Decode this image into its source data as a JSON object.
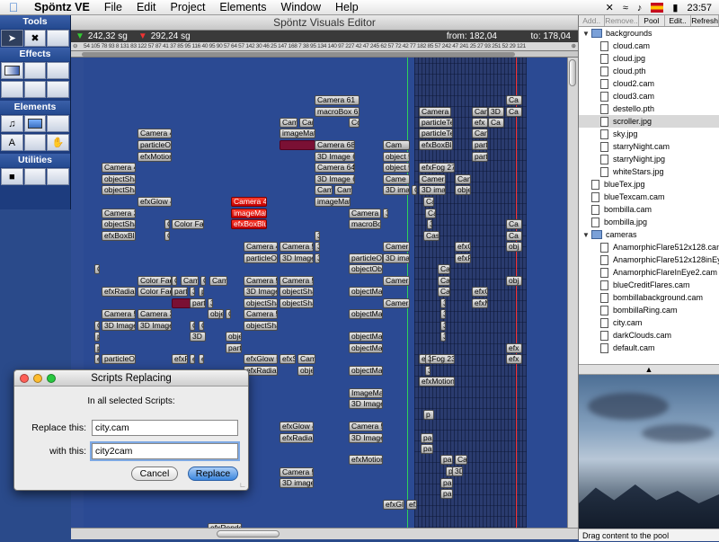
{
  "menubar": {
    "app": "Spöntz VE",
    "items": [
      "File",
      "Edit",
      "Project",
      "Elements",
      "Window",
      "Help"
    ],
    "time": "23:57"
  },
  "tools": {
    "sections": [
      "Tools",
      "Effects",
      "Elements",
      "Utilities"
    ]
  },
  "editor": {
    "title": "Spöntz Visuals Editor",
    "pos1": "242,32 sg",
    "pos2": "292,24 sg",
    "from_label": "from: 182,04",
    "to_label": "to: 178,04",
    "ruler": "54 105 78 93 8 131 83 122 57 87 41 37 85 95 116 40 95 90 57 64 57 142 30 46 25 147 168 7 38 95 134 140 97 227 42 47 245 62 57 72 42 77 182 85 57 242 47 241 25 27 93 251 52 29 121"
  },
  "clips": [
    [
      "Camera 61",
      257,
      42,
      50
    ],
    [
      "macroBox 62",
      257,
      55,
      50
    ],
    [
      "Cam",
      218,
      67,
      20
    ],
    [
      "Cam",
      240,
      67,
      16
    ],
    [
      "Co",
      295,
      67,
      12
    ],
    [
      "imageMatr",
      218,
      79,
      40
    ],
    [
      "",
      218,
      92,
      40,
      "mar"
    ],
    [
      "Camera 4",
      60,
      79,
      38
    ],
    [
      "particleOb",
      60,
      92,
      38
    ],
    [
      "efxMotion",
      60,
      105,
      38
    ],
    [
      "Camera 68",
      257,
      92,
      45
    ],
    [
      "3D Image 69",
      257,
      105,
      45
    ],
    [
      "Camera 64",
      257,
      117,
      45
    ],
    [
      "3D Image 65",
      257,
      130,
      45
    ],
    [
      "Cam",
      257,
      142,
      20
    ],
    [
      "Cam",
      279,
      142,
      20
    ],
    [
      "Camera 4",
      20,
      117,
      38
    ],
    [
      "objectSha",
      20,
      130,
      38
    ],
    [
      "objectSha",
      20,
      142,
      38
    ],
    [
      "efxGlow 4",
      60,
      155,
      38
    ],
    [
      "imageMatr",
      257,
      155,
      40
    ],
    [
      "Camera 4",
      164,
      155,
      40,
      "red"
    ],
    [
      "imageMatr",
      164,
      168,
      40,
      "red"
    ],
    [
      "efxBoxBlu",
      164,
      180,
      40,
      "red"
    ],
    [
      "Camera 7",
      295,
      168,
      36
    ],
    [
      "3",
      333,
      168,
      5
    ],
    [
      "macroBox",
      295,
      180,
      36
    ],
    [
      "Camera 3",
      20,
      168,
      38
    ],
    [
      "objectSha",
      20,
      180,
      38
    ],
    [
      "C",
      90,
      180,
      6
    ],
    [
      "Color Fad",
      98,
      180,
      36
    ],
    [
      "efxBoxBlu",
      20,
      193,
      38
    ],
    [
      "C",
      90,
      193,
      6
    ],
    [
      "3",
      257,
      193,
      5
    ],
    [
      "3",
      257,
      205,
      5
    ],
    [
      "3",
      257,
      218,
      5
    ],
    [
      "Camera 4",
      178,
      205,
      38
    ],
    [
      "Camera 5",
      218,
      205,
      38
    ],
    [
      "particleOb",
      178,
      218,
      38
    ],
    [
      "3D Image",
      218,
      218,
      38
    ],
    [
      "C",
      12,
      230,
      6
    ],
    [
      "Camera 5",
      60,
      243,
      38
    ],
    [
      "Color Fad",
      60,
      243,
      38
    ],
    [
      "C",
      98,
      243,
      6
    ],
    [
      "Cam",
      108,
      243,
      20
    ],
    [
      "Cam",
      140,
      243,
      20
    ],
    [
      "C",
      130,
      243,
      6
    ],
    [
      "Camera 5",
      178,
      243,
      38
    ],
    [
      "Camera 5",
      218,
      243,
      38
    ],
    [
      "efxRadial",
      20,
      255,
      38
    ],
    [
      "Color Fad",
      60,
      255,
      38
    ],
    [
      "parti",
      98,
      255,
      18
    ],
    [
      "3",
      118,
      255,
      6
    ],
    [
      "p",
      128,
      255,
      6
    ],
    [
      "3D Image",
      178,
      255,
      38
    ],
    [
      "objectSha",
      218,
      255,
      38
    ],
    [
      "",
      98,
      268,
      30,
      "mar"
    ],
    [
      "parti",
      118,
      268,
      18
    ],
    [
      "3",
      138,
      268,
      6
    ],
    [
      "objectSha",
      178,
      268,
      38
    ],
    [
      "objectSha",
      218,
      268,
      38
    ],
    [
      "Camera 5",
      20,
      280,
      38
    ],
    [
      "Camera 3",
      60,
      280,
      38
    ],
    [
      "obje",
      138,
      280,
      18
    ],
    [
      "C",
      158,
      280,
      6
    ],
    [
      "Camera 5",
      178,
      280,
      38
    ],
    [
      "C",
      12,
      293,
      6
    ],
    [
      "3D Image",
      20,
      293,
      38
    ],
    [
      "3D Image",
      60,
      293,
      38
    ],
    [
      "C",
      118,
      293,
      6
    ],
    [
      "C",
      128,
      293,
      6
    ],
    [
      "objectSha",
      178,
      293,
      38
    ],
    [
      "3D I",
      118,
      305,
      18
    ],
    [
      "obje",
      158,
      305,
      18
    ],
    [
      "parti",
      158,
      318,
      18
    ],
    [
      "p",
      12,
      318,
      6
    ],
    [
      "p",
      12,
      305,
      6
    ],
    [
      "efx",
      12,
      330,
      6
    ],
    [
      "particleOb",
      20,
      330,
      38
    ],
    [
      "efxR",
      98,
      330,
      18
    ],
    [
      "ef",
      118,
      330,
      6
    ],
    [
      "ef",
      128,
      330,
      6
    ],
    [
      "efxGlow 5",
      178,
      330,
      38
    ],
    [
      "efxS",
      218,
      330,
      18
    ],
    [
      "Cam",
      238,
      330,
      20
    ],
    [
      "efxRadial",
      178,
      343,
      38
    ],
    [
      "obje",
      238,
      343,
      18
    ],
    [
      "",
      60,
      355,
      18,
      "mar"
    ],
    [
      "Cam",
      80,
      355,
      20
    ],
    [
      "objectMatr",
      295,
      255,
      38
    ],
    [
      "objectMatr",
      295,
      280,
      38
    ],
    [
      "objectMatr",
      295,
      305,
      38
    ],
    [
      "objectMatr",
      295,
      318,
      38
    ],
    [
      "objectMatr",
      295,
      343,
      38
    ],
    [
      "particleOb",
      295,
      218,
      38
    ],
    [
      "objectOb",
      295,
      230,
      38
    ],
    [
      "ImageMatr",
      295,
      368,
      38
    ],
    [
      "3D Image",
      295,
      380,
      38
    ],
    [
      "Camera 5",
      295,
      405,
      38
    ],
    [
      "3D Image",
      295,
      418,
      38
    ],
    [
      "efxMotion",
      295,
      442,
      38
    ],
    [
      "efxGlow 4",
      218,
      405,
      38
    ],
    [
      "efxRadial",
      218,
      418,
      38
    ],
    [
      "Camera 5",
      218,
      456,
      38
    ],
    [
      "3D image",
      218,
      468,
      38
    ],
    [
      "efxGlo",
      333,
      492,
      24
    ],
    [
      "efx",
      359,
      492,
      12
    ],
    [
      "efxRender",
      138,
      518,
      38
    ],
    [
      "efxFog 236",
      373,
      330,
      40
    ],
    [
      "efxMotionB",
      373,
      355,
      40
    ],
    [
      "Cam",
      333,
      92,
      30
    ],
    [
      "object 5",
      333,
      105,
      30
    ],
    [
      "object 5",
      333,
      117,
      30
    ],
    [
      "Came",
      333,
      130,
      30
    ],
    [
      "3D ima",
      333,
      142,
      30
    ],
    [
      "C",
      365,
      142,
      6
    ],
    [
      "Camera 2",
      373,
      55,
      36
    ],
    [
      "particleTex",
      373,
      67,
      38
    ],
    [
      "particleTex",
      373,
      79,
      38
    ],
    [
      "efxBoxBlu",
      373,
      92,
      38
    ],
    [
      "efxFog 271",
      373,
      117,
      40
    ],
    [
      "Camera",
      373,
      130,
      30
    ],
    [
      "3D ima",
      373,
      142,
      30
    ],
    [
      "Camera",
      333,
      205,
      30
    ],
    [
      "3D ima",
      333,
      218,
      30
    ],
    [
      "Camera",
      333,
      243,
      30
    ],
    [
      "Camera",
      333,
      268,
      30
    ],
    [
      "Cam",
      432,
      55,
      18
    ],
    [
      "3D I",
      450,
      55,
      18
    ],
    [
      "Ca",
      470,
      42,
      18
    ],
    [
      "Ca",
      470,
      55,
      18
    ],
    [
      "efx",
      432,
      67,
      18
    ],
    [
      "Ca",
      450,
      67,
      18
    ],
    [
      "Cam",
      432,
      79,
      18
    ],
    [
      "part",
      432,
      105,
      18
    ],
    [
      "part",
      432,
      92,
      18
    ],
    [
      "obje",
      413,
      142,
      18
    ],
    [
      "Cam",
      413,
      130,
      18
    ],
    [
      "Ca",
      470,
      180,
      18
    ],
    [
      "Ca",
      470,
      193,
      18
    ],
    [
      "obj",
      470,
      205,
      18
    ],
    [
      "obj",
      470,
      243,
      18
    ],
    [
      "efx",
      470,
      318,
      18
    ],
    [
      "efx",
      470,
      330,
      18
    ],
    [
      "efxG",
      432,
      255,
      18
    ],
    [
      "efxM",
      432,
      268,
      18
    ],
    [
      "efxR",
      413,
      218,
      18
    ],
    [
      "efxG",
      413,
      205,
      18
    ],
    [
      "Ca",
      378,
      155,
      12
    ],
    [
      "Ca",
      380,
      168,
      12
    ],
    [
      "Cas",
      378,
      193,
      18
    ],
    [
      "3",
      382,
      180,
      6
    ],
    [
      "Ca",
      394,
      230,
      14
    ],
    [
      "Ca",
      394,
      243,
      14
    ],
    [
      "Ca",
      394,
      255,
      14
    ],
    [
      "3",
      397,
      268,
      6
    ],
    [
      "3",
      397,
      280,
      6
    ],
    [
      "p",
      378,
      392,
      12
    ],
    [
      "pa",
      375,
      418,
      14
    ],
    [
      "pa",
      375,
      430,
      14
    ],
    [
      "pa",
      397,
      442,
      14
    ],
    [
      "Ca",
      413,
      442,
      14
    ],
    [
      "p",
      403,
      455,
      8
    ],
    [
      "3D",
      410,
      455,
      12
    ],
    [
      "pa",
      397,
      468,
      14
    ],
    [
      "pa",
      397,
      480,
      14
    ],
    [
      "3",
      397,
      293,
      6
    ],
    [
      "3",
      397,
      305,
      6
    ],
    [
      "3",
      380,
      330,
      6
    ],
    [
      "3",
      380,
      343,
      6
    ]
  ],
  "pool": {
    "toolbar": [
      "Add..",
      "Remove..",
      "Pool",
      "Edit..",
      "Refresh"
    ],
    "items": [
      {
        "t": "backgrounds",
        "kind": "folder"
      },
      {
        "t": "cloud.cam",
        "kind": "file",
        "ind": 1
      },
      {
        "t": "cloud.jpg",
        "kind": "file",
        "ind": 1
      },
      {
        "t": "cloud.pth",
        "kind": "file",
        "ind": 1
      },
      {
        "t": "cloud2.cam",
        "kind": "file",
        "ind": 1
      },
      {
        "t": "cloud3.cam",
        "kind": "file",
        "ind": 1
      },
      {
        "t": "destello.pth",
        "kind": "file",
        "ind": 1
      },
      {
        "t": "scroller.jpg",
        "kind": "file",
        "ind": 1,
        "sel": true
      },
      {
        "t": "sky.jpg",
        "kind": "file",
        "ind": 1
      },
      {
        "t": "starryNight.cam",
        "kind": "file",
        "ind": 1
      },
      {
        "t": "starryNight.jpg",
        "kind": "file",
        "ind": 1
      },
      {
        "t": "whiteStars.jpg",
        "kind": "file",
        "ind": 1
      },
      {
        "t": "blueTex.jpg",
        "kind": "file",
        "ind": 0
      },
      {
        "t": "blueTexcam.cam",
        "kind": "file",
        "ind": 0
      },
      {
        "t": "bombilla.cam",
        "kind": "file",
        "ind": 0
      },
      {
        "t": "bombilla.jpg",
        "kind": "file",
        "ind": 0
      },
      {
        "t": "cameras",
        "kind": "folder"
      },
      {
        "t": "AnamorphicFlare512x128.cam",
        "kind": "file",
        "ind": 1
      },
      {
        "t": "AnamorphicFlare512x128inEye.cam",
        "kind": "file",
        "ind": 1
      },
      {
        "t": "AnamorphicFlareInEye2.cam",
        "kind": "file",
        "ind": 1
      },
      {
        "t": "blueCreditFlares.cam",
        "kind": "file",
        "ind": 1
      },
      {
        "t": "bombillabackground.cam",
        "kind": "file",
        "ind": 1
      },
      {
        "t": "bombillaRing.cam",
        "kind": "file",
        "ind": 1
      },
      {
        "t": "city.cam",
        "kind": "file",
        "ind": 1
      },
      {
        "t": "darkClouds.cam",
        "kind": "file",
        "ind": 1
      },
      {
        "t": "default.cam",
        "kind": "file",
        "ind": 1
      }
    ],
    "status": "Drag content to the pool"
  },
  "dialog": {
    "title": "Scripts Replacing",
    "heading": "In all selected Scripts:",
    "replace_label": "Replace this:",
    "replace_value": "city.cam",
    "with_label": "with this:",
    "with_value": "city2cam",
    "cancel": "Cancel",
    "ok": "Replace"
  },
  "colors": {
    "accent": "#3b86dd",
    "selected_clip": "#d01010",
    "timeline_bg": "#2b4a93"
  }
}
